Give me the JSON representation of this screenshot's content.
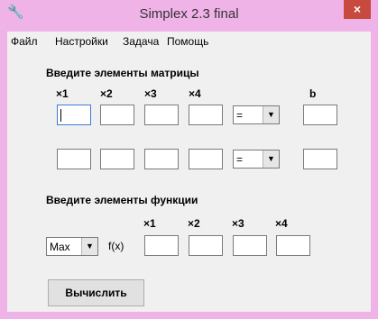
{
  "window": {
    "title": "Simplex 2.3 final",
    "close_glyph": "×",
    "app_icon": "wrench-icon"
  },
  "menu": [
    "Файл",
    "Настройки",
    "Задача",
    "Помощь"
  ],
  "matrix": {
    "heading": "Введите элементы матрицы",
    "vars": [
      "×1",
      "×2",
      "×3",
      "×4"
    ],
    "b_label": "b",
    "rows": [
      {
        "sign": "=",
        "values": [
          "",
          "",
          "",
          ""
        ],
        "b": ""
      },
      {
        "sign": "=",
        "values": [
          "",
          "",
          "",
          ""
        ],
        "b": ""
      }
    ]
  },
  "function": {
    "heading": "Введите элементы функции",
    "vars": [
      "×1",
      "×2",
      "×3",
      "×4"
    ],
    "mode": "Max",
    "f_label": "f(x)",
    "values": [
      "",
      "",
      "",
      ""
    ]
  },
  "compute_button": "Вычислить"
}
